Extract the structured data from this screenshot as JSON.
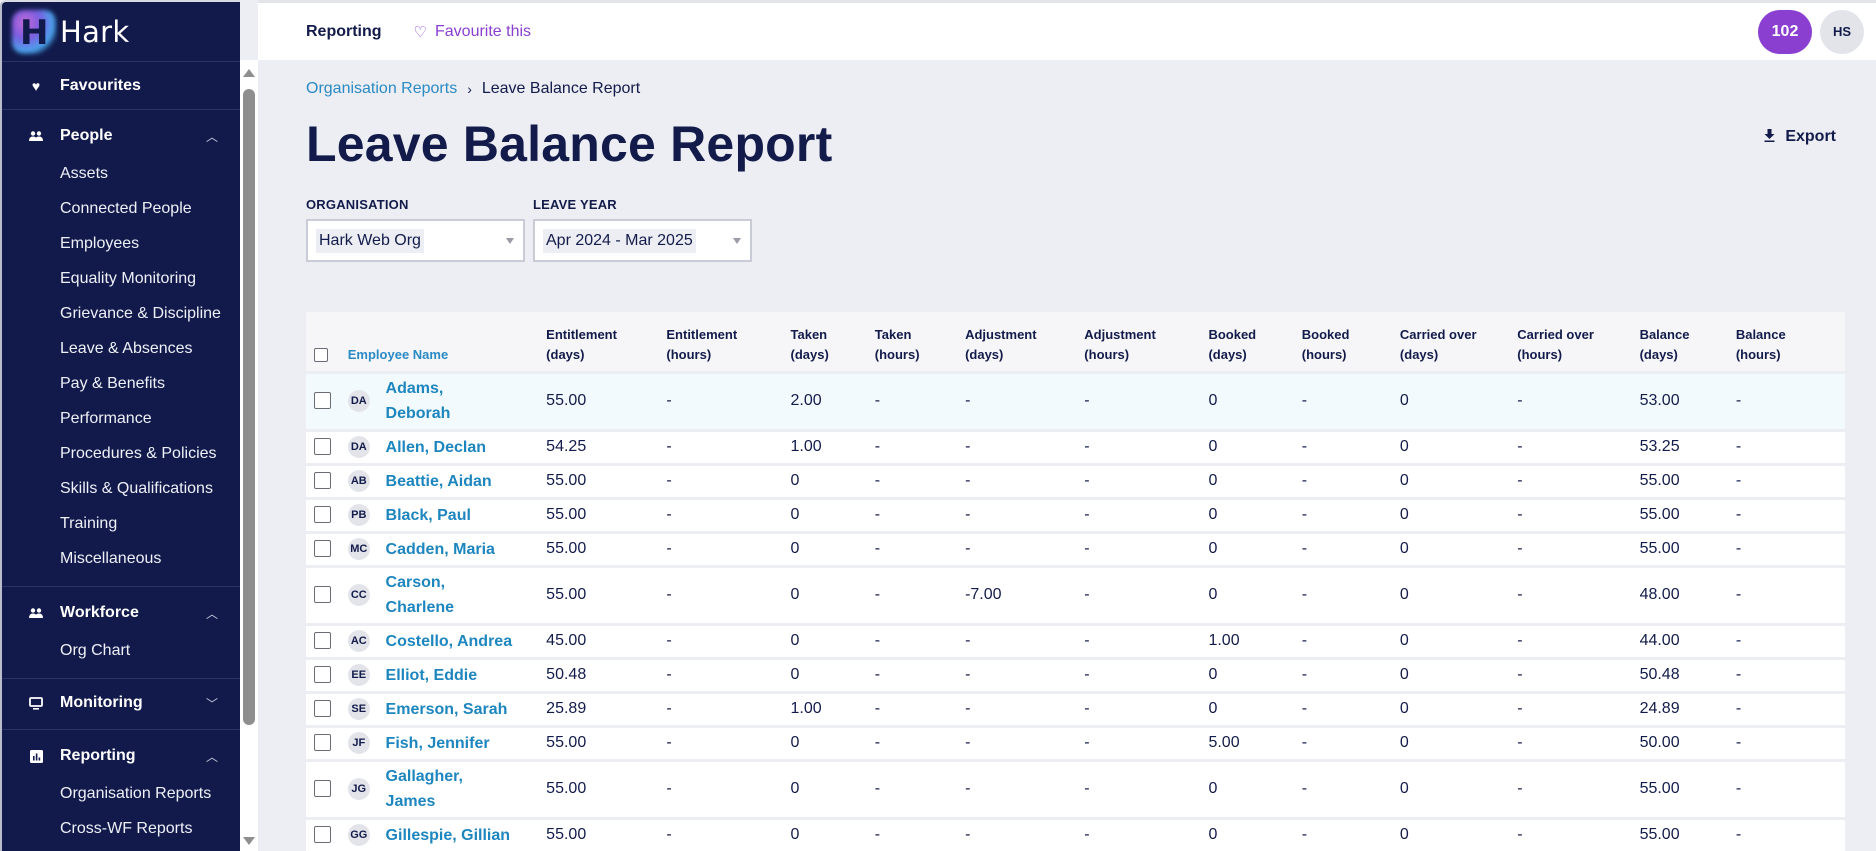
{
  "app": {
    "name": "Hark"
  },
  "sidebar": {
    "favourites": {
      "label": "Favourites",
      "icon": "heart-icon"
    },
    "sections": [
      {
        "label": "People",
        "icon": "people-icon",
        "expanded": true,
        "items": [
          "Assets",
          "Connected People",
          "Employees",
          "Equality Monitoring",
          "Grievance & Discipline",
          "Leave & Absences",
          "Pay & Benefits",
          "Performance",
          "Procedures & Policies",
          "Skills & Qualifications",
          "Training",
          "Miscellaneous"
        ]
      },
      {
        "label": "Workforce",
        "icon": "people-icon",
        "expanded": true,
        "items": [
          "Org Chart"
        ]
      },
      {
        "label": "Monitoring",
        "icon": "monitor-icon",
        "expanded": false,
        "items": []
      },
      {
        "label": "Reporting",
        "icon": "bar-chart-icon",
        "expanded": true,
        "items": [
          "Organisation Reports",
          "Cross-WF Reports"
        ]
      }
    ]
  },
  "topbar": {
    "section": "Reporting",
    "favourite_label": "Favourite this",
    "notification_count": "102",
    "user_initials": "HS"
  },
  "breadcrumb": {
    "parent": "Organisation Reports",
    "separator": "›",
    "current": "Leave Balance Report"
  },
  "page": {
    "title": "Leave Balance Report",
    "export_label": "Export"
  },
  "filters": {
    "organisation": {
      "label": "ORGANISATION",
      "value": "Hark Web Org"
    },
    "leave_year": {
      "label": "LEAVE YEAR",
      "value": "Apr 2024 - Mar 2025"
    }
  },
  "table": {
    "columns": [
      {
        "key": "name",
        "line1": "Employee Name",
        "line2": ""
      },
      {
        "key": "ent_d",
        "line1": "Entitlement",
        "line2": "(days)"
      },
      {
        "key": "ent_h",
        "line1": "Entitlement",
        "line2": "(hours)"
      },
      {
        "key": "tak_d",
        "line1": "Taken",
        "line2": "(days)"
      },
      {
        "key": "tak_h",
        "line1": "Taken",
        "line2": "(hours)"
      },
      {
        "key": "adj_d",
        "line1": "Adjustment",
        "line2": "(days)"
      },
      {
        "key": "adj_h",
        "line1": "Adjustment",
        "line2": "(hours)"
      },
      {
        "key": "bok_d",
        "line1": "Booked",
        "line2": "(days)"
      },
      {
        "key": "bok_h",
        "line1": "Booked",
        "line2": "(hours)"
      },
      {
        "key": "car_d",
        "line1": "Carried over",
        "line2": "(days)"
      },
      {
        "key": "car_h",
        "line1": "Carried over",
        "line2": "(hours)"
      },
      {
        "key": "bal_d",
        "line1": "Balance",
        "line2": "(days)"
      },
      {
        "key": "bal_h",
        "line1": "Balance",
        "line2": "(hours)"
      }
    ],
    "rows": [
      {
        "initials": "DA",
        "name_l1": "Adams,",
        "name_l2": "Deborah",
        "values": [
          "55.00",
          "-",
          "2.00",
          "-",
          "-",
          "-",
          "0",
          "-",
          "0",
          "-",
          "53.00",
          "-"
        ],
        "highlighted": true
      },
      {
        "initials": "DA",
        "name_l1": "Allen, Declan",
        "name_l2": "",
        "values": [
          "54.25",
          "-",
          "1.00",
          "-",
          "-",
          "-",
          "0",
          "-",
          "0",
          "-",
          "53.25",
          "-"
        ]
      },
      {
        "initials": "AB",
        "name_l1": "Beattie, Aidan",
        "name_l2": "",
        "values": [
          "55.00",
          "-",
          "0",
          "-",
          "-",
          "-",
          "0",
          "-",
          "0",
          "-",
          "55.00",
          "-"
        ]
      },
      {
        "initials": "PB",
        "name_l1": "Black, Paul",
        "name_l2": "",
        "values": [
          "55.00",
          "-",
          "0",
          "-",
          "-",
          "-",
          "0",
          "-",
          "0",
          "-",
          "55.00",
          "-"
        ]
      },
      {
        "initials": "MC",
        "name_l1": "Cadden, Maria",
        "name_l2": "",
        "values": [
          "55.00",
          "-",
          "0",
          "-",
          "-",
          "-",
          "0",
          "-",
          "0",
          "-",
          "55.00",
          "-"
        ]
      },
      {
        "initials": "CC",
        "name_l1": "Carson,",
        "name_l2": "Charlene",
        "values": [
          "55.00",
          "-",
          "0",
          "-",
          "-7.00",
          "-",
          "0",
          "-",
          "0",
          "-",
          "48.00",
          "-"
        ]
      },
      {
        "initials": "AC",
        "name_l1": "Costello, Andrea",
        "name_l2": "",
        "values": [
          "45.00",
          "-",
          "0",
          "-",
          "-",
          "-",
          "1.00",
          "-",
          "0",
          "-",
          "44.00",
          "-"
        ]
      },
      {
        "initials": "EE",
        "name_l1": "Elliot, Eddie",
        "name_l2": "",
        "values": [
          "50.48",
          "-",
          "0",
          "-",
          "-",
          "-",
          "0",
          "-",
          "0",
          "-",
          "50.48",
          "-"
        ]
      },
      {
        "initials": "SE",
        "name_l1": "Emerson, Sarah",
        "name_l2": "",
        "values": [
          "25.89",
          "-",
          "1.00",
          "-",
          "-",
          "-",
          "0",
          "-",
          "0",
          "-",
          "24.89",
          "-"
        ]
      },
      {
        "initials": "JF",
        "name_l1": "Fish, Jennifer",
        "name_l2": "",
        "values": [
          "55.00",
          "-",
          "0",
          "-",
          "-",
          "-",
          "5.00",
          "-",
          "0",
          "-",
          "50.00",
          "-"
        ]
      },
      {
        "initials": "JG",
        "name_l1": "Gallagher,",
        "name_l2": "James",
        "values": [
          "55.00",
          "-",
          "0",
          "-",
          "-",
          "-",
          "0",
          "-",
          "0",
          "-",
          "55.00",
          "-"
        ]
      },
      {
        "initials": "GG",
        "name_l1": "Gillespie, Gillian",
        "name_l2": "",
        "values": [
          "55.00",
          "-",
          "0",
          "-",
          "-",
          "-",
          "0",
          "-",
          "0",
          "-",
          "55.00",
          "-"
        ]
      }
    ]
  },
  "colors": {
    "sidebar_bg": "#111a4b",
    "accent_purple": "#8a3fd1",
    "link_blue": "#1e86bf",
    "page_bg": "#edeef3",
    "text_dark": "#121b4a"
  }
}
